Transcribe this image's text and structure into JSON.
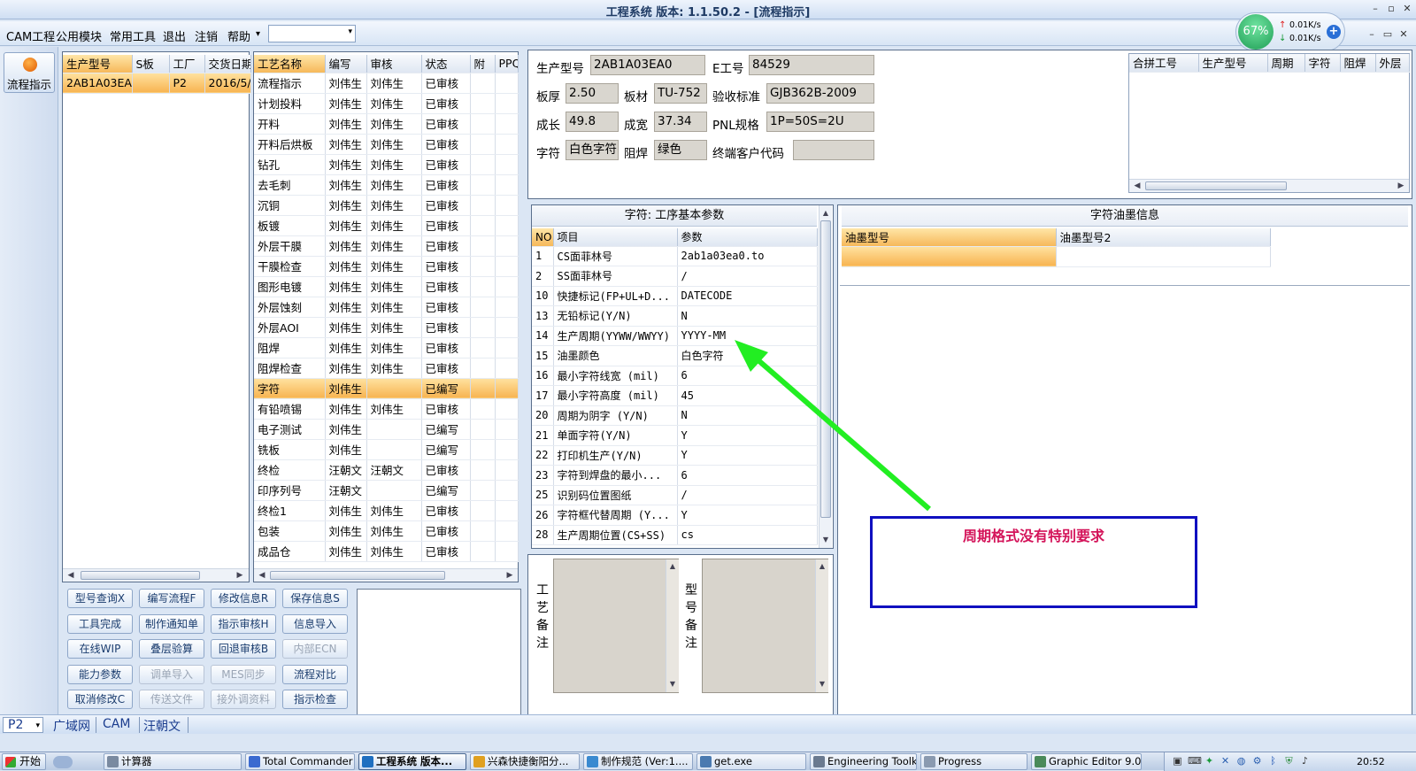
{
  "window": {
    "title": "工程系统  版本: 1.1.50.2 - [流程指示]",
    "minimize": "–",
    "restore": "▫",
    "close": "✕"
  },
  "menubar": {
    "items": [
      "CAM工程",
      "公用模块",
      "常用工具",
      "退出",
      "注销",
      "帮助"
    ],
    "dropdown_arrow": "▾",
    "combo_value": "",
    "inner_min": "–",
    "inner_restore": "▭",
    "inner_close": "✕"
  },
  "netmon": {
    "percent": "67%",
    "up": "0.01K/s",
    "down": "0.01K/s",
    "up_arrow": "↑",
    "down_arrow": "↓",
    "plus": "+"
  },
  "side": {
    "flow_button_label": "流程指示"
  },
  "model_grid": {
    "headers": [
      "生产型号",
      "S板",
      "工厂",
      "交货日期"
    ],
    "rows": [
      [
        "2AB1A03EA0",
        "",
        "P2",
        "2016/5/"
      ]
    ]
  },
  "process_grid": {
    "headers": [
      "工艺名称",
      "编写",
      "审核",
      "状态",
      "附",
      "PPQ"
    ],
    "rows": [
      [
        "流程指示",
        "刘伟生",
        "刘伟生",
        "已审核"
      ],
      [
        "计划投料",
        "刘伟生",
        "刘伟生",
        "已审核"
      ],
      [
        "开料",
        "刘伟生",
        "刘伟生",
        "已审核"
      ],
      [
        "开料后烘板",
        "刘伟生",
        "刘伟生",
        "已审核"
      ],
      [
        "钻孔",
        "刘伟生",
        "刘伟生",
        "已审核"
      ],
      [
        "去毛刺",
        "刘伟生",
        "刘伟生",
        "已审核"
      ],
      [
        "沉铜",
        "刘伟生",
        "刘伟生",
        "已审核"
      ],
      [
        "板镀",
        "刘伟生",
        "刘伟生",
        "已审核"
      ],
      [
        "外层干膜",
        "刘伟生",
        "刘伟生",
        "已审核"
      ],
      [
        "干膜检查",
        "刘伟生",
        "刘伟生",
        "已审核"
      ],
      [
        "图形电镀",
        "刘伟生",
        "刘伟生",
        "已审核"
      ],
      [
        "外层蚀刻",
        "刘伟生",
        "刘伟生",
        "已审核"
      ],
      [
        "外层AOI",
        "刘伟生",
        "刘伟生",
        "已审核"
      ],
      [
        "阻焊",
        "刘伟生",
        "刘伟生",
        "已审核"
      ],
      [
        "阻焊检查",
        "刘伟生",
        "刘伟生",
        "已审核"
      ],
      [
        "字符",
        "刘伟生",
        "",
        "已编写"
      ],
      [
        "有铅喷锡",
        "刘伟生",
        "刘伟生",
        "已审核"
      ],
      [
        "电子测试",
        "刘伟生",
        "",
        "已编写"
      ],
      [
        "铣板",
        "刘伟生",
        "",
        "已编写"
      ],
      [
        "终检",
        "汪朝文",
        "汪朝文",
        "已审核"
      ],
      [
        "印序列号",
        "汪朝文",
        "",
        "已编写"
      ],
      [
        "终检1",
        "刘伟生",
        "刘伟生",
        "已审核"
      ],
      [
        "包装",
        "刘伟生",
        "刘伟生",
        "已审核"
      ],
      [
        "成品仓",
        "刘伟生",
        "刘伟生",
        "已审核"
      ]
    ],
    "selected_index": 15
  },
  "buttons": [
    [
      "型号查询X",
      "编写流程F",
      "修改信息R",
      "保存信息S"
    ],
    [
      "工具完成",
      "制作通知单",
      "指示审核H",
      "信息导入"
    ],
    [
      "在线WIP",
      "叠层验算",
      "回退审核B",
      "内部ECN"
    ],
    [
      "能力参数",
      "调单导入",
      "MES同步",
      "流程对比"
    ],
    [
      "取消修改C",
      "传送文件",
      "接外调资料",
      "指示检查"
    ]
  ],
  "disabled_buttons": [
    "内部ECN",
    "调单导入",
    "MES同步",
    "传送文件",
    "接外调资料"
  ],
  "info": {
    "fields": [
      {
        "label": "生产型号",
        "value": "2AB1A03EA0"
      },
      {
        "label": "E工号",
        "value": "84529"
      },
      {
        "label": "板厚",
        "value": "2.50"
      },
      {
        "label": "板材",
        "value": "TU-752"
      },
      {
        "label": "验收标准",
        "value": "GJB362B-2009"
      },
      {
        "label": "成长",
        "value": "49.8"
      },
      {
        "label": "成宽",
        "value": "37.34"
      },
      {
        "label": "PNL规格",
        "value": "1P=50S=2U"
      },
      {
        "label": "字符",
        "value": "白色字符"
      },
      {
        "label": "阻焊",
        "value": "绿色"
      },
      {
        "label": "终端客户代码",
        "value": ""
      }
    ]
  },
  "combine_grid": {
    "headers": [
      "合拼工号",
      "生产型号",
      "周期",
      "字符",
      "阻焊",
      "外层"
    ]
  },
  "param_panel": {
    "title": "字符: 工序基本参数",
    "headers": [
      "NO",
      "项目",
      "参数"
    ],
    "rows": [
      [
        "1",
        "CS面菲林号",
        "2ab1a03ea0.to"
      ],
      [
        "2",
        "SS面菲林号",
        "/"
      ],
      [
        "10",
        "快捷标记(FP+UL+D...",
        "DATECODE"
      ],
      [
        "13",
        "无铅标记(Y/N)",
        "N"
      ],
      [
        "14",
        "生产周期(YYWW/WWYY)",
        "YYYY-MM"
      ],
      [
        "15",
        "油墨颜色",
        "白色字符"
      ],
      [
        "16",
        "最小字符线宽 (mil)",
        "6"
      ],
      [
        "17",
        "最小字符高度 (mil)",
        "45"
      ],
      [
        "20",
        "周期为阴字 (Y/N)",
        "N"
      ],
      [
        "21",
        "单面字符(Y/N)",
        "Y"
      ],
      [
        "22",
        "打印机生产(Y/N)",
        "Y"
      ],
      [
        "23",
        "字符到焊盘的最小...",
        "6"
      ],
      [
        "25",
        "识别码位置图纸",
        "/"
      ],
      [
        "26",
        "字符框代替周期 (Y...",
        "Y"
      ],
      [
        "28",
        "生产周期位置(CS+SS)",
        "cs"
      ]
    ]
  },
  "ink_panel": {
    "title": "字符油墨信息",
    "headers": [
      "油墨型号",
      "油墨型号2"
    ]
  },
  "remarks": {
    "process_label": "工艺备注",
    "model_label": "型号备注"
  },
  "annotation": {
    "text": "周期格式没有特别要求",
    "arrow_color": "#22ee22",
    "box_color": "#1010c0",
    "text_color": "#d4145a"
  },
  "statusbar": {
    "combo": "P2",
    "tabs": [
      "广域网",
      "CAM",
      "汪朝文"
    ]
  },
  "taskbar": {
    "start": "开始",
    "tasks": [
      {
        "label": "计算器",
        "active": false
      },
      {
        "label": "Total Commander ...",
        "active": false
      },
      {
        "label": "工程系统  版本...",
        "active": true
      },
      {
        "label": "兴森快捷衡阳分...",
        "active": false
      },
      {
        "label": "制作规范 (Ver:1....",
        "active": false
      },
      {
        "label": "get.exe",
        "active": false
      },
      {
        "label": "Engineering Toolki...",
        "active": false
      },
      {
        "label": "Progress",
        "active": false
      },
      {
        "label": "Graphic Editor 9.0...",
        "active": false
      }
    ],
    "clock": "20:52"
  }
}
